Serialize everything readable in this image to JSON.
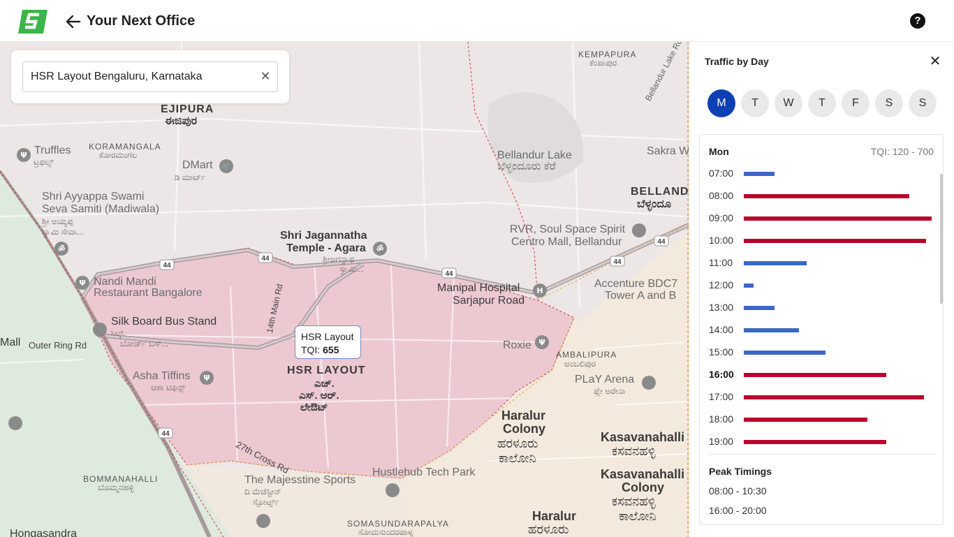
{
  "header": {
    "title": "Your Next Office",
    "help_label": "?"
  },
  "search": {
    "value": "HSR Layout Bengaluru, Karnataka",
    "clear_label": "✕"
  },
  "map": {
    "tooltip": {
      "name": "HSR Layout",
      "tqi_label": "TQI:",
      "tqi_value": "655"
    },
    "labels": {
      "ejipura": "EJIPURA",
      "ejipura_kn": "ಈಜಿಪುರ",
      "koramangala": "KORAMANGALA",
      "koramangala_kn": "ಕೋರಮಂಗಲ",
      "truffles": "Truffles",
      "truffles_kn": "ಟ್ರಫಲ್ಸ್",
      "dmart": "DMart",
      "dmart_kn": "ಡಿ ಮಾರ್ಟ್",
      "ayyappa_1": "Shri Ayyappa Swami",
      "ayyappa_2": "Seva Samiti (Madiwala)",
      "ayyappa_kn1": "ಶ್ರೀ ಅಯ್ಯಪ್ಪ",
      "ayyappa_kn2": "ಸ್ವಾಮಿ ಸೇವಾ...",
      "jagannatha_1": "Shri Jagannatha",
      "jagannatha_2": "Temple - Agara",
      "jagannatha_kn1": "ಶ್ರೀಜಗನ್ನಾಥ",
      "jagannatha_kn2": "ಸ್ವಾಮಿ...",
      "kempapura": "KEMPAPURA",
      "kempapura_kn": "ಕೆಂಪಾಪುರ",
      "bellandur_lake_1": "Bellandur Lake",
      "bellandur_lake_kn": "ಬೆಳ್ಳಂದೂರು ಕೆರೆ",
      "bellandur_lake_rd": "Bellandur Lake Rd",
      "sakra": "Sakra W",
      "bellandur": "BELLAND",
      "bellandur_kn": "ಬೆಳ್ಳಂದೂ",
      "rvr_1": "RVR, Soul Space Spirit",
      "rvr_2": "Centro Mall, Bellandur",
      "nandi_1": "Nandi Mandi",
      "nandi_2": "Restaurant Bangalore",
      "silk_board": "Silk Board Bus Stand",
      "silk_board_kn1": "ಸಿಲ್ಕ್",
      "silk_board_kn2": "ಬೋರ್ಡ್ ಬಸ್...",
      "mall": "Mall",
      "outer_ring": "Outer Ring Rd",
      "main_14": "14th Main Rd",
      "manipal_1": "Manipal Hospital",
      "manipal_2": "Sarjapur Road",
      "accenture_1": "Accenture BDC7",
      "accenture_2": "Tower A and B",
      "roxie": "Roxie",
      "ambalipura": "AMBALIPURA",
      "ambalipura_kn": "ಅಂಬಲಿಪುರ",
      "play_arena": "PLaY Arena",
      "play_arena_kn": "ಪ್ಲೇ ಅರೇನಾ",
      "asha_tiffins": "Asha Tiffins",
      "asha_tiffins_kn": "ಆಶಾ ಟಿಫಿನ್ಸ್",
      "hsr_layout": "HSR LAYOUT",
      "hsr_kn1": "ಎಚ್.",
      "hsr_kn2": "ಎಸ್. ಅರ್.",
      "hsr_kn3": "ಲೇಔಟ್",
      "haralur_colony_1": "Haralur",
      "haralur_colony_2": "Colony",
      "haralur_colony_kn1": "ಹರಳೂರು",
      "haralur_colony_kn2": "ಕಾಲೋನಿ",
      "kasavanahalli": "Kasavanahalli",
      "kasavanahalli_kn": "ಕಸವನಹಳ್ಳಿ",
      "kasavanahalli_colony_1": "Kasavanahalli",
      "kasavanahalli_colony_2": "Colony",
      "kasavanahalli_colony_kn1": "ಕಸವನಹಳ್ಳಿ",
      "kasavanahalli_colony_kn2": "ಕಾಲೋನಿ",
      "cross_27": "27th Cross Rd",
      "hustlehub": "Hustlehub Tech Park",
      "majesstine": "The Majesstine Sports",
      "majesstine_kn1": "ದಿ ಮೆಜೆಸ್ಟೀನ್",
      "majesstine_kn2": "ಸ್ಪೋರ್ಟ್ಸ್",
      "bommanahalli": "BOMMANAHALLI",
      "bommanahalli_kn": "ಬೊಮ್ಮನಹಳ್ಳಿ",
      "somasundarapalya": "SOMASUNDARAPALYA",
      "somasundarapalya_kn": "ಸೋಮಸುಂದರಪಾಳ್ಯ",
      "haralur": "Haralur",
      "haralur_kn": "ಹರಳೂರು",
      "hongasandra": "Hongasandra",
      "road_44": "44"
    }
  },
  "panel": {
    "title": "Traffic by Day",
    "close_label": "✕",
    "days": [
      {
        "label": "M",
        "active": true
      },
      {
        "label": "T",
        "active": false
      },
      {
        "label": "W",
        "active": false
      },
      {
        "label": "T",
        "active": false
      },
      {
        "label": "F",
        "active": false
      },
      {
        "label": "S",
        "active": false
      },
      {
        "label": "S",
        "active": false
      }
    ],
    "selected_day": "Mon",
    "tqi_range": "TQI: 120 - 700",
    "tqi_min": 120,
    "tqi_max": 700,
    "hours": [
      {
        "time": "07:00",
        "level": "low",
        "fraction": 0.16
      },
      {
        "time": "08:00",
        "level": "high",
        "fraction": 0.87
      },
      {
        "time": "09:00",
        "level": "high",
        "fraction": 0.99
      },
      {
        "time": "10:00",
        "level": "high",
        "fraction": 0.96
      },
      {
        "time": "11:00",
        "level": "low",
        "fraction": 0.33
      },
      {
        "time": "12:00",
        "level": "low",
        "fraction": 0.05
      },
      {
        "time": "13:00",
        "level": "low",
        "fraction": 0.16
      },
      {
        "time": "14:00",
        "level": "low",
        "fraction": 0.29
      },
      {
        "time": "15:00",
        "level": "low",
        "fraction": 0.43
      },
      {
        "time": "16:00",
        "level": "high",
        "fraction": 0.75,
        "current": true
      },
      {
        "time": "17:00",
        "level": "high",
        "fraction": 0.95
      },
      {
        "time": "18:00",
        "level": "high",
        "fraction": 0.65
      },
      {
        "time": "19:00",
        "level": "high",
        "fraction": 0.75
      }
    ],
    "peak_title": "Peak Timings",
    "peaks": [
      "08:00  - 10:30",
      "16:00 - 20:00"
    ],
    "colors": {
      "low": "#3c66c9",
      "high": "#b8042c",
      "active_day": "#0f3fb4"
    }
  }
}
